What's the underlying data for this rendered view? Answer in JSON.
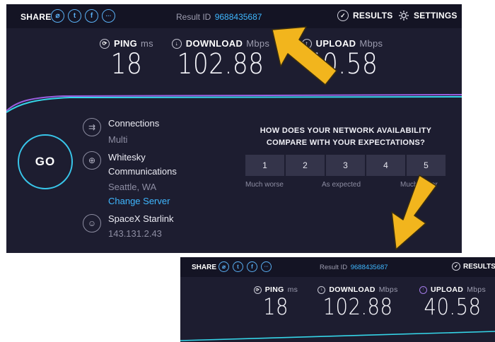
{
  "main": {
    "share_label": "SHARE",
    "share_icons": [
      "link-icon",
      "twitter-icon",
      "facebook-icon",
      "more-icon"
    ],
    "share_glyphs": [
      "⌀",
      "t",
      "f",
      "···"
    ],
    "result_id_label": "Result ID",
    "result_id": "9688435687",
    "results_label": "RESULTS",
    "settings_label": "SETTINGS",
    "ping": {
      "label": "PING",
      "unit": "ms",
      "value": "18"
    },
    "download": {
      "label": "DOWNLOAD",
      "unit": "Mbps",
      "value": "102.88"
    },
    "upload": {
      "label": "UPLOAD",
      "unit": "Mbps",
      "value": "40.58"
    },
    "go_label": "GO",
    "connections": {
      "title": "Connections",
      "value": "Multi"
    },
    "isp": {
      "name_line1": "Whitesky",
      "name_line2": "Communications",
      "location": "Seattle, WA",
      "change_server": "Change Server"
    },
    "client": {
      "name": "SpaceX Starlink",
      "ip": "143.131.2.43"
    },
    "survey": {
      "question_line1": "HOW DOES YOUR NETWORK AVAILABILITY",
      "question_line2": "COMPARE WITH YOUR EXPECTATIONS?",
      "ratings": [
        "1",
        "2",
        "3",
        "4",
        "5"
      ],
      "scale_low": "Much worse",
      "scale_mid": "As expected",
      "scale_high": "Much better"
    }
  },
  "zoom": {
    "share_label": "SHARE",
    "result_id_label": "Result ID",
    "result_id": "9688435687",
    "results_label": "RESULTS",
    "ping": {
      "label": "PING",
      "unit": "ms",
      "value": "18"
    },
    "download": {
      "label": "DOWNLOAD",
      "unit": "Mbps",
      "value": "102.88"
    },
    "upload": {
      "label": "UPLOAD",
      "unit": "Mbps",
      "value": "40.58"
    }
  },
  "colors": {
    "panel_bg": "#1d1d30",
    "accent_blue": "#3fb7ff",
    "go_ring": "#38c6ea",
    "arrow_yellow": "#f2b51d",
    "graph_cyan": "#35d5e8",
    "graph_purple": "#9a5fe0"
  }
}
